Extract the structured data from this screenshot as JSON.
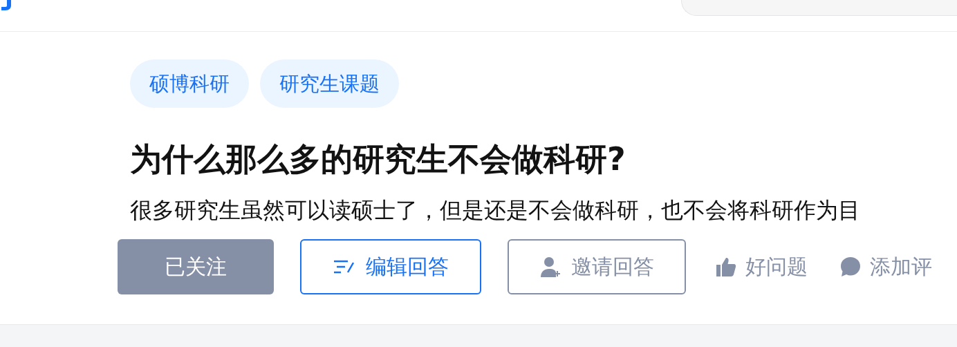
{
  "question": {
    "tags": [
      {
        "label": "硕博科研"
      },
      {
        "label": "研究生课题"
      }
    ],
    "title": "为什么那么多的研究生不会做科研?",
    "excerpt": "很多研究生虽然可以读硕士了，但是还是不会做科研，也不会将科研作为目",
    "actions": [
      {
        "kind": "follow",
        "label": "已关注",
        "followed": true
      },
      {
        "kind": "edit",
        "label": "编辑回答"
      },
      {
        "kind": "invite",
        "label": "邀请回答"
      },
      {
        "kind": "like",
        "label": "好问题"
      },
      {
        "kind": "comment",
        "label": "添加评"
      }
    ]
  }
}
